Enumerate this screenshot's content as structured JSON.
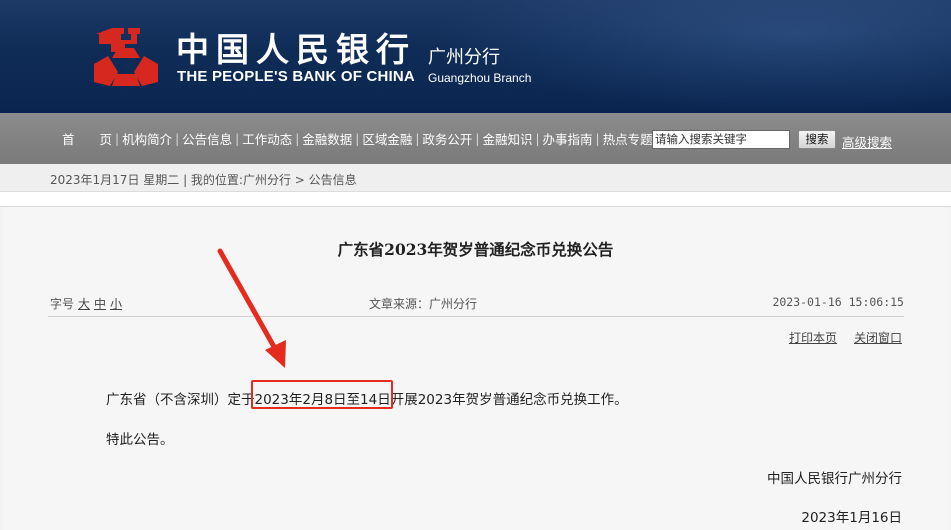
{
  "header": {
    "bank_name_cn": "中国人民银行",
    "bank_name_en": "THE PEOPLE'S BANK OF CHINA",
    "branch_cn": "广州分行",
    "branch_en": "Guangzhou  Branch",
    "logo_icon": "pboc-emblem-icon",
    "brand_color": "#0f2c57",
    "emblem_color": "#d6281e"
  },
  "nav": {
    "items": [
      "首　　页",
      "机构简介",
      "公告信息",
      "工作动态",
      "金融数据",
      "区域金融",
      "政务公开",
      "金融知识",
      "办事指南",
      "热点专题"
    ],
    "search_placeholder": "请输入搜索关键字",
    "search_button": "搜索",
    "advanced_search": "高级搜索"
  },
  "breadcrumb": {
    "text": "2023年1月17日 星期二 | 我的位置:广州分行  >  公告信息"
  },
  "article": {
    "title": "广东省2023年贺岁普通纪念币兑换公告",
    "font_size_label": "字号",
    "font_size_large": "大",
    "font_size_medium": "中",
    "font_size_small": "小",
    "source": "文章来源：广州分行",
    "date": "2023-01-16 15:06:15",
    "print_label": "打印本页",
    "close_label": "关闭窗口",
    "para1_before": "广东省（不含深圳）定于",
    "para1_highlight": "2023年2月8日至14日",
    "para1_after": "开展2023年贺岁普通纪念币兑换工作。",
    "para2": "特此公告。",
    "signer": "中国人民银行广州分行",
    "sign_date": "2023年1月16日"
  },
  "annotation": {
    "color": "#e52b1e"
  }
}
